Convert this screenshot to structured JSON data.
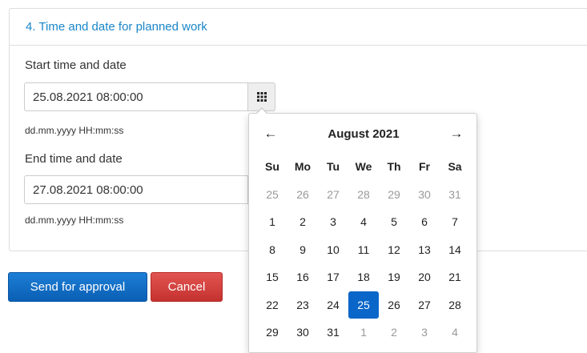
{
  "section": {
    "title": "4. Time and date for planned work"
  },
  "start": {
    "label": "Start time and date",
    "value": "25.08.2021 08:00:00",
    "format_hint": "dd.mm.yyyy HH:mm:ss"
  },
  "end": {
    "label": "End time and date",
    "value": "27.08.2021 08:00:00",
    "format_hint": "dd.mm.yyyy HH:mm:ss"
  },
  "actions": {
    "send_label": "Send for approval",
    "cancel_label": "Cancel"
  },
  "datepicker": {
    "prev_glyph": "←",
    "next_glyph": "→",
    "month_title": "August 2021",
    "weekdays": [
      "Su",
      "Mo",
      "Tu",
      "We",
      "Th",
      "Fr",
      "Sa"
    ],
    "days": [
      {
        "d": "25",
        "muted": true
      },
      {
        "d": "26",
        "muted": true
      },
      {
        "d": "27",
        "muted": true
      },
      {
        "d": "28",
        "muted": true
      },
      {
        "d": "29",
        "muted": true
      },
      {
        "d": "30",
        "muted": true
      },
      {
        "d": "31",
        "muted": true
      },
      {
        "d": "1"
      },
      {
        "d": "2"
      },
      {
        "d": "3"
      },
      {
        "d": "4"
      },
      {
        "d": "5"
      },
      {
        "d": "6"
      },
      {
        "d": "7"
      },
      {
        "d": "8"
      },
      {
        "d": "9"
      },
      {
        "d": "10"
      },
      {
        "d": "11"
      },
      {
        "d": "12"
      },
      {
        "d": "13"
      },
      {
        "d": "14"
      },
      {
        "d": "15"
      },
      {
        "d": "16"
      },
      {
        "d": "17"
      },
      {
        "d": "18"
      },
      {
        "d": "19"
      },
      {
        "d": "20"
      },
      {
        "d": "21"
      },
      {
        "d": "22"
      },
      {
        "d": "23"
      },
      {
        "d": "24"
      },
      {
        "d": "25",
        "selected": true
      },
      {
        "d": "26"
      },
      {
        "d": "27"
      },
      {
        "d": "28"
      },
      {
        "d": "29"
      },
      {
        "d": "30"
      },
      {
        "d": "31"
      },
      {
        "d": "1",
        "muted": true
      },
      {
        "d": "2",
        "muted": true
      },
      {
        "d": "3",
        "muted": true
      },
      {
        "d": "4",
        "muted": true
      }
    ],
    "selected_color": "#0a66c8",
    "muted_color": "#999999"
  },
  "icons": {
    "calendar": "calendar-grid-icon"
  },
  "colors": {
    "heading": "#1a86c8",
    "primary": "#0a5fb4",
    "danger": "#c4322f"
  }
}
